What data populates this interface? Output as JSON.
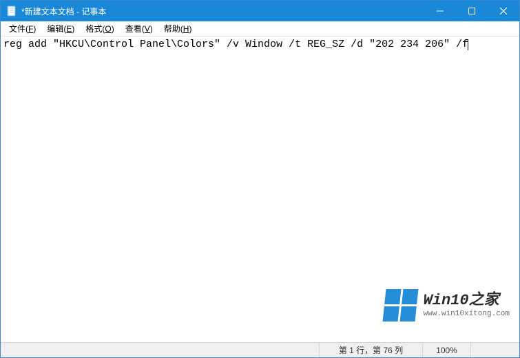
{
  "titlebar": {
    "title": "*新建文本文档 - 记事本"
  },
  "menubar": {
    "items": [
      {
        "label": "文件",
        "mnemonic": "F"
      },
      {
        "label": "编辑",
        "mnemonic": "E"
      },
      {
        "label": "格式",
        "mnemonic": "O"
      },
      {
        "label": "查看",
        "mnemonic": "V"
      },
      {
        "label": "帮助",
        "mnemonic": "H"
      }
    ]
  },
  "editor": {
    "text": "reg add \"HKCU\\Control Panel\\Colors\" /v Window /t REG_SZ /d \"202 234 206\" /f"
  },
  "statusbar": {
    "position": "第 1 行，第 76 列",
    "zoom": "100%"
  },
  "watermark": {
    "brand": "Win10之家",
    "url": "www.win10xitong.com"
  },
  "colors": {
    "accent": "#1b87d7"
  }
}
